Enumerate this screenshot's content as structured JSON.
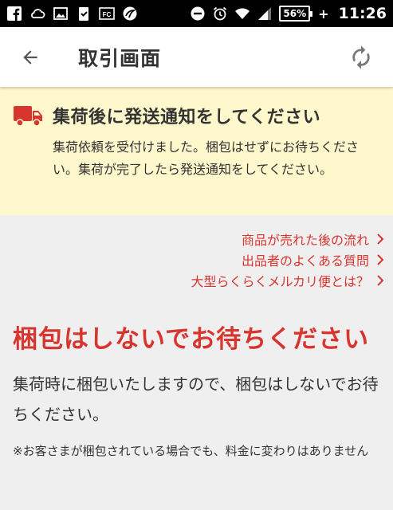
{
  "status_bar": {
    "battery": "56%",
    "charging": "+",
    "time": "11:26"
  },
  "app_bar": {
    "title": "取引画面"
  },
  "notice": {
    "title": "集荷後に発送通知をしてください",
    "body": "集荷依頼を受付けました。梱包はせずにお待ちください。集荷が完了したら発送通知をしてください。"
  },
  "links": [
    {
      "label": "商品が売れた後の流れ"
    },
    {
      "label": "出品者のよくある質問"
    },
    {
      "label": "大型らくらくメルカリ便とは？"
    }
  ],
  "main": {
    "heading": "梱包はしないでお待ちください",
    "body": "集荷時に梱包いたしますので、梱包はしないでお待ちください。",
    "note": "※お客さまが梱包されている場合でも、料金に変わりはありません"
  },
  "colors": {
    "accent": "#d9352f",
    "notice_bg": "#fff8cc",
    "page_bg": "#efefef"
  }
}
